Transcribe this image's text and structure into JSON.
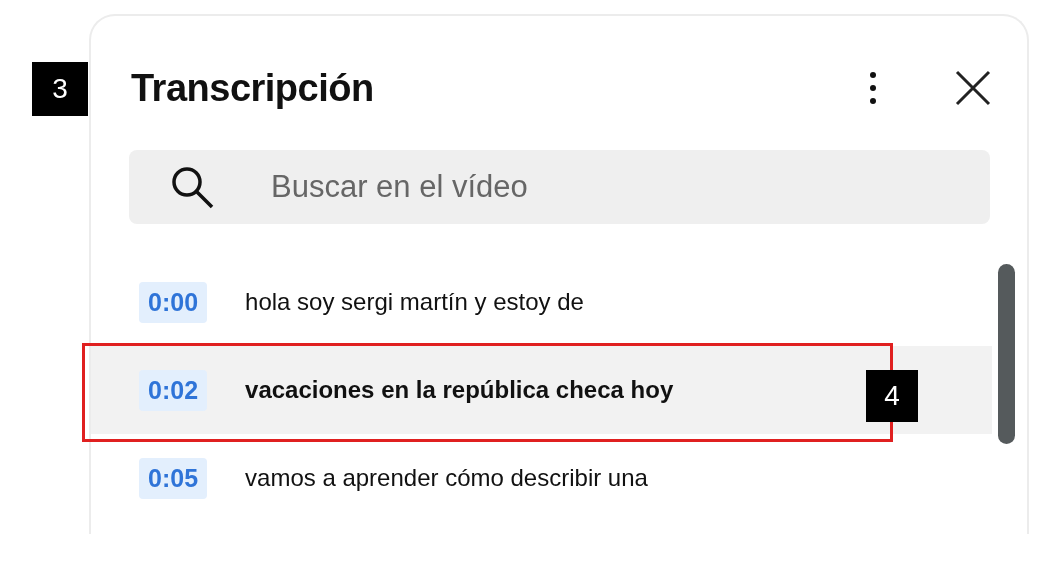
{
  "panel": {
    "title": "Transcripción"
  },
  "search": {
    "placeholder": "Buscar en el vídeo"
  },
  "segments": [
    {
      "time": "0:00",
      "text": "hola soy sergi martín y estoy de",
      "selected": false
    },
    {
      "time": "0:02",
      "text": "vacaciones en la república checa hoy",
      "selected": true
    },
    {
      "time": "0:05",
      "text": "vamos a aprender cómo describir una",
      "selected": false
    }
  ],
  "annotations": [
    "3",
    "4"
  ]
}
